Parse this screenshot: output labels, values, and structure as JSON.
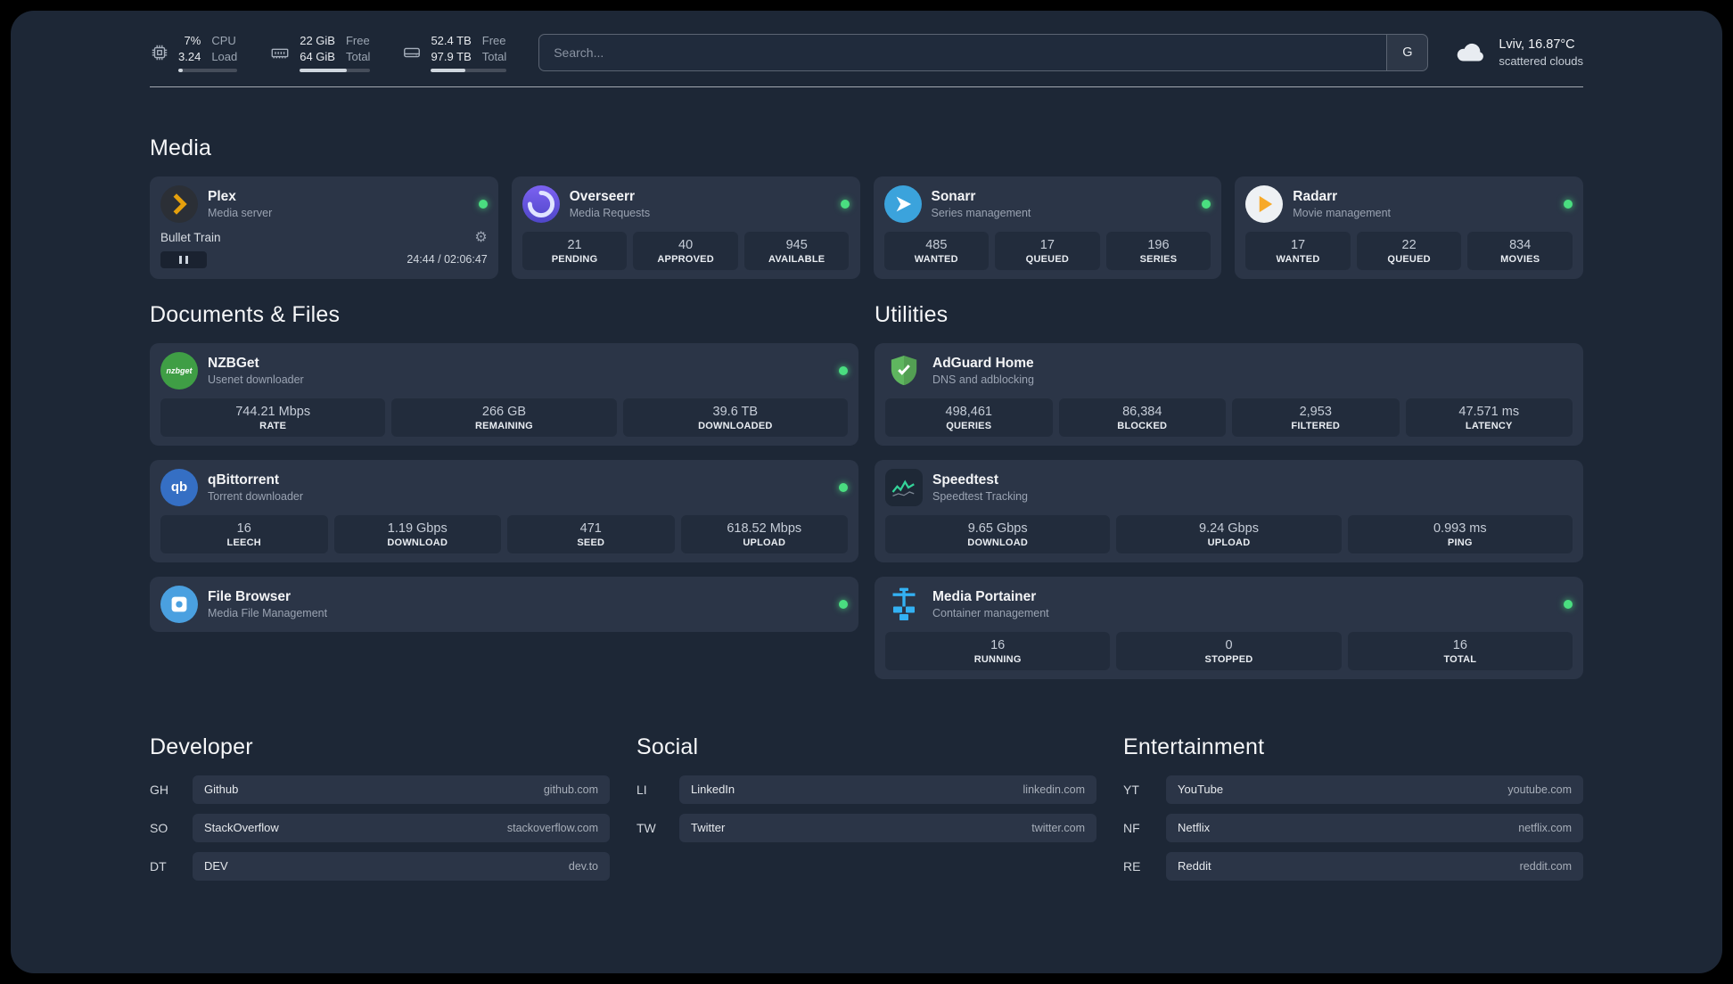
{
  "colors": {
    "background": "#1d2736",
    "card": "#2b3547",
    "stat_tile": "#222c3c",
    "status_online": "#4ade80",
    "plex_accent": "#e5a00d"
  },
  "topbar": {
    "resources": [
      {
        "icon": "cpu-icon",
        "primary": "7%",
        "secondary": "3.24",
        "primary_label": "CPU",
        "secondary_label": "Load",
        "progress_percent": 7
      },
      {
        "icon": "memory-icon",
        "primary": "22 GiB",
        "secondary": "64 GiB",
        "primary_label": "Free",
        "secondary_label": "Total",
        "progress_percent": 66
      },
      {
        "icon": "disk-icon",
        "primary": "52.4 TB",
        "secondary": "97.9 TB",
        "primary_label": "Free",
        "secondary_label": "Total",
        "progress_percent": 46
      }
    ],
    "search": {
      "placeholder": "Search...",
      "provider_label": "G"
    },
    "weather": {
      "location": "Lviv, 16.87°C",
      "condition": "scattered clouds"
    }
  },
  "sections": {
    "media": {
      "title": "Media",
      "plex": {
        "name": "Plex",
        "subtitle": "Media server",
        "status": "online",
        "player_title": "Bullet Train",
        "player_time": "24:44 / 02:06:47"
      },
      "overseerr": {
        "name": "Overseerr",
        "subtitle": "Media Requests",
        "status": "online",
        "stats": [
          {
            "value": "21",
            "label": "PENDING"
          },
          {
            "value": "40",
            "label": "APPROVED"
          },
          {
            "value": "945",
            "label": "AVAILABLE"
          }
        ]
      },
      "sonarr": {
        "name": "Sonarr",
        "subtitle": "Series management",
        "status": "online",
        "stats": [
          {
            "value": "485",
            "label": "WANTED"
          },
          {
            "value": "17",
            "label": "QUEUED"
          },
          {
            "value": "196",
            "label": "SERIES"
          }
        ]
      },
      "radarr": {
        "name": "Radarr",
        "subtitle": "Movie management",
        "status": "online",
        "stats": [
          {
            "value": "17",
            "label": "WANTED"
          },
          {
            "value": "22",
            "label": "QUEUED"
          },
          {
            "value": "834",
            "label": "MOVIES"
          }
        ]
      }
    },
    "documents": {
      "title": "Documents & Files",
      "nzbget": {
        "name": "NZBGet",
        "subtitle": "Usenet downloader",
        "status": "online",
        "icon_text": "nzbget",
        "stats": [
          {
            "value": "744.21 Mbps",
            "label": "RATE"
          },
          {
            "value": "266 GB",
            "label": "REMAINING"
          },
          {
            "value": "39.6 TB",
            "label": "DOWNLOADED"
          }
        ]
      },
      "qbittorrent": {
        "name": "qBittorrent",
        "subtitle": "Torrent downloader",
        "status": "online",
        "icon_text": "qb",
        "stats": [
          {
            "value": "16",
            "label": "LEECH"
          },
          {
            "value": "1.19 Gbps",
            "label": "DOWNLOAD"
          },
          {
            "value": "471",
            "label": "SEED"
          },
          {
            "value": "618.52 Mbps",
            "label": "UPLOAD"
          }
        ]
      },
      "filebrowser": {
        "name": "File Browser",
        "subtitle": "Media File Management",
        "status": "online"
      }
    },
    "utilities": {
      "title": "Utilities",
      "adguard": {
        "name": "AdGuard Home",
        "subtitle": "DNS and adblocking",
        "stats": [
          {
            "value": "498,461",
            "label": "QUERIES"
          },
          {
            "value": "86,384",
            "label": "BLOCKED"
          },
          {
            "value": "2,953",
            "label": "FILTERED"
          },
          {
            "value": "47.571 ms",
            "label": "LATENCY"
          }
        ]
      },
      "speedtest": {
        "name": "Speedtest",
        "subtitle": "Speedtest Tracking",
        "stats": [
          {
            "value": "9.65 Gbps",
            "label": "DOWNLOAD"
          },
          {
            "value": "9.24 Gbps",
            "label": "UPLOAD"
          },
          {
            "value": "0.993 ms",
            "label": "PING"
          }
        ]
      },
      "portainer": {
        "name": "Media Portainer",
        "subtitle": "Container management",
        "status": "online",
        "stats": [
          {
            "value": "16",
            "label": "RUNNING"
          },
          {
            "value": "0",
            "label": "STOPPED"
          },
          {
            "value": "16",
            "label": "TOTAL"
          }
        ]
      }
    },
    "bookmarks": {
      "developer": {
        "title": "Developer",
        "items": [
          {
            "abbr": "GH",
            "name": "Github",
            "domain": "github.com"
          },
          {
            "abbr": "SO",
            "name": "StackOverflow",
            "domain": "stackoverflow.com"
          },
          {
            "abbr": "DT",
            "name": "DEV",
            "domain": "dev.to"
          }
        ]
      },
      "social": {
        "title": "Social",
        "items": [
          {
            "abbr": "LI",
            "name": "LinkedIn",
            "domain": "linkedin.com"
          },
          {
            "abbr": "TW",
            "name": "Twitter",
            "domain": "twitter.com"
          }
        ]
      },
      "entertainment": {
        "title": "Entertainment",
        "items": [
          {
            "abbr": "YT",
            "name": "YouTube",
            "domain": "youtube.com"
          },
          {
            "abbr": "NF",
            "name": "Netflix",
            "domain": "netflix.com"
          },
          {
            "abbr": "RE",
            "name": "Reddit",
            "domain": "reddit.com"
          }
        ]
      }
    }
  }
}
